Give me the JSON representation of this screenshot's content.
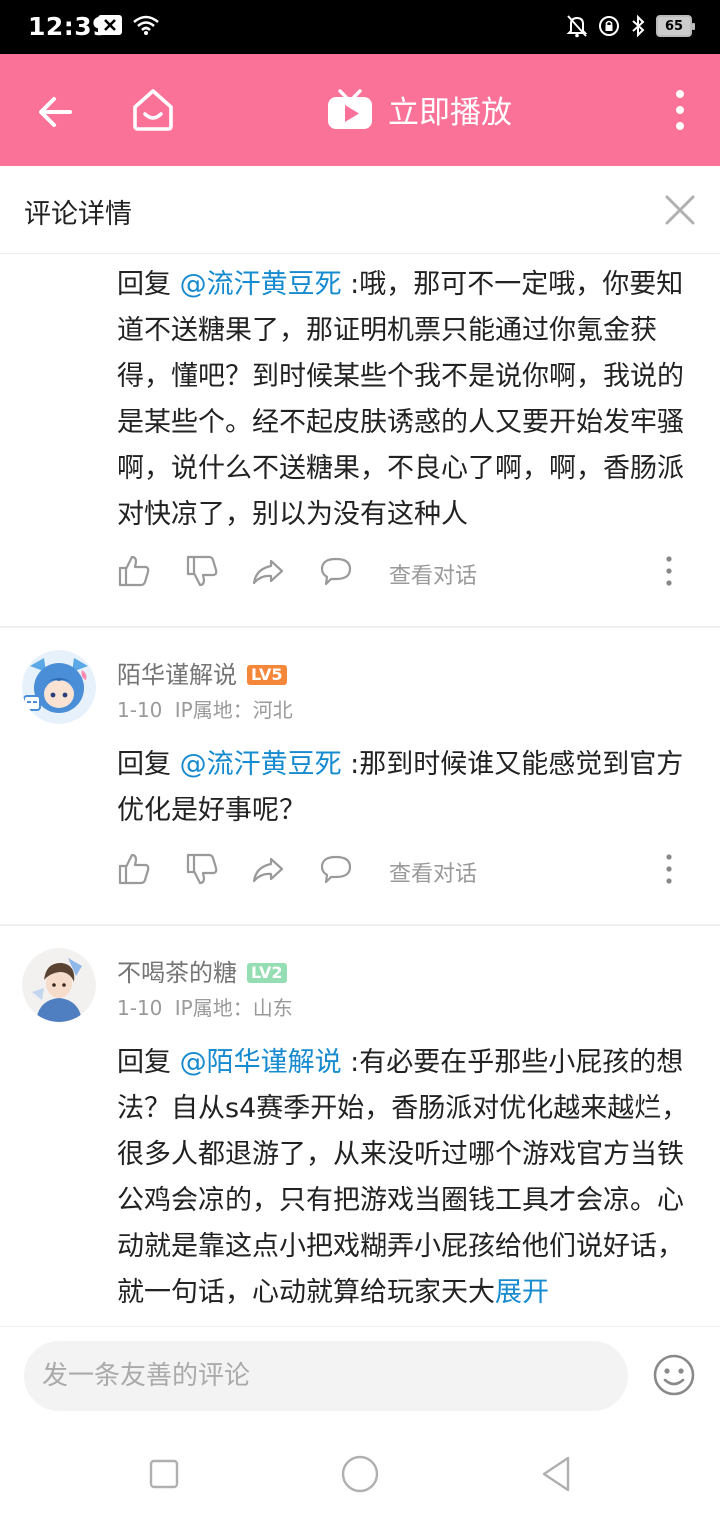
{
  "status_bar": {
    "time": "12:39",
    "battery": "65"
  },
  "app_bar": {
    "play_label": "立即播放",
    "accent_color": "#fb7299"
  },
  "detail_header": {
    "title": "评论详情"
  },
  "comments": [
    {
      "reply_prefix": "回复 ",
      "mention": "@流汗黄豆死",
      "text": " :哦，那可不一定哦，你要知道不送糖果了，那证明机票只能通过你氪金获得，懂吧？到时候某些个我不是说你啊，我说的是某些个。经不起皮肤诱惑的人又要开始发牢骚啊，说什么不送糖果，不良心了啊，啊，香肠派对快凉了，别以为没有这种人",
      "view_conversation": "查看对话"
    },
    {
      "username": "陌华谨解说",
      "level": "LV5",
      "level_color": "#f5873a",
      "date": "1-10",
      "ip_location": "IP属地：河北",
      "reply_prefix": "回复 ",
      "mention": "@流汗黄豆死",
      "text": " :那到时候谁又能感觉到官方优化是好事呢？",
      "view_conversation": "查看对话"
    },
    {
      "username": "不喝茶的糖",
      "level": "LV2",
      "level_color": "#95ddb2",
      "date": "1-10",
      "ip_location": "IP属地：山东",
      "reply_prefix": "回复 ",
      "mention": "@陌华谨解说",
      "text": " :有必要在乎那些小屁孩的想法？自从s4赛季开始，香肠派对优化越来越烂，很多人都退游了，从来没听过哪个游戏官方当铁公鸡会凉的，只有把游戏当圈钱工具才会凉。心动就是靠这点小把戏糊弄小屁孩给他们说好话，就一句话，心动就算给玩家天大",
      "expand_label": "展开"
    }
  ],
  "input": {
    "placeholder": "发一条友善的评论"
  }
}
